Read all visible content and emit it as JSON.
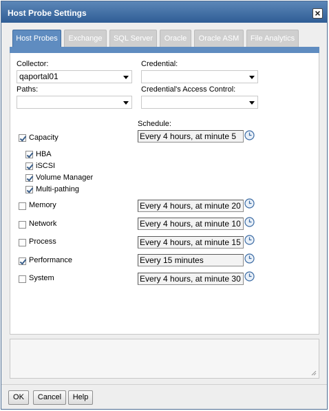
{
  "dialog": {
    "title": "Host Probe Settings"
  },
  "tabs": [
    {
      "label": "Host Probes",
      "active": true
    },
    {
      "label": "Exchange",
      "active": false
    },
    {
      "label": "SQL Server",
      "active": false
    },
    {
      "label": "Oracle",
      "active": false
    },
    {
      "label": "Oracle ASM",
      "active": false
    },
    {
      "label": "File Analytics",
      "active": false
    }
  ],
  "form": {
    "collector_label": "Collector:",
    "collector_value": "qaportal01",
    "credential_label": "Credential:",
    "credential_value": "",
    "paths_label": "Paths:",
    "paths_value": "",
    "access_control_label": "Credential's Access Control:",
    "access_control_value": "",
    "schedule_label": "Schedule:"
  },
  "probes": [
    {
      "label": "Capacity",
      "checked": true,
      "schedule": "Every 4 hours, at minute 5",
      "sub": [
        {
          "label": "HBA",
          "checked": true
        },
        {
          "label": "iSCSI",
          "checked": true
        },
        {
          "label": "Volume Manager",
          "checked": true
        },
        {
          "label": "Multi-pathing",
          "checked": true
        }
      ]
    },
    {
      "label": "Memory",
      "checked": false,
      "schedule": "Every 4 hours, at minute 20"
    },
    {
      "label": "Network",
      "checked": false,
      "schedule": "Every 4 hours, at minute 10"
    },
    {
      "label": "Process",
      "checked": false,
      "schedule": "Every 4 hours, at minute 15"
    },
    {
      "label": "Performance",
      "checked": true,
      "schedule": "Every 15 minutes"
    },
    {
      "label": "System",
      "checked": false,
      "schedule": "Every 4 hours, at minute 30"
    }
  ],
  "buttons": {
    "ok": "OK",
    "cancel": "Cancel",
    "help": "Help"
  },
  "icons": {
    "close": "close-icon",
    "clock": "clock-icon",
    "dropdown": "chevron-down-icon"
  },
  "colors": {
    "titlebar": "#3a6aa3",
    "active_tab": "#5f8cc0",
    "inactive_tab": "#cfcfcf"
  }
}
